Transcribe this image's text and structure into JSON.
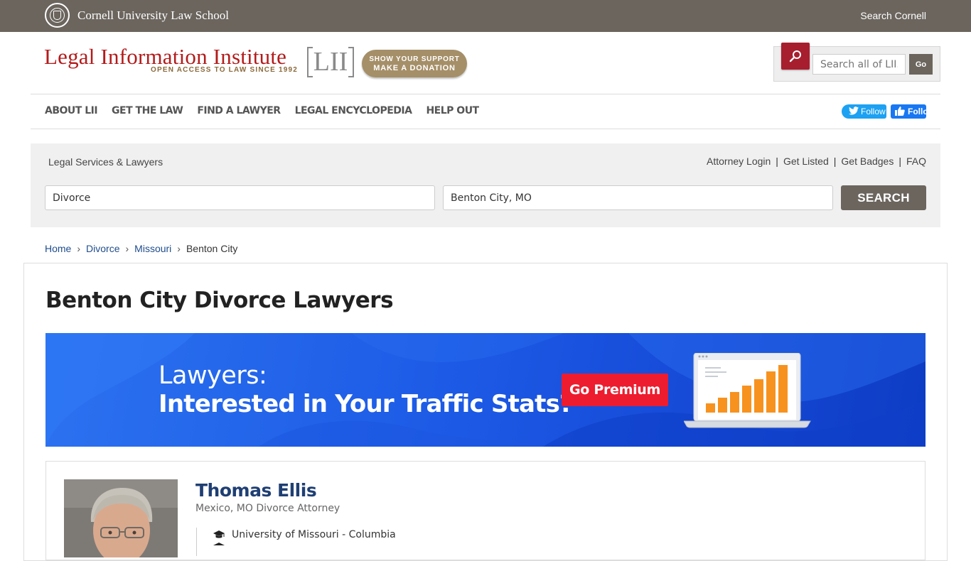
{
  "cornell_bar": {
    "name": "Cornell University Law School",
    "search_link": "Search Cornell"
  },
  "header": {
    "title": "Legal Information Institute",
    "tagline": "OPEN ACCESS TO LAW SINCE 1992",
    "mark": "LII",
    "donate": {
      "line1": "SHOW YOUR SUPPORT",
      "line2": "MAKE A DONATION"
    },
    "search": {
      "placeholder": "Search all of LII...",
      "go_label": "Go",
      "icon": "search-icon"
    }
  },
  "nav": {
    "items": [
      "ABOUT LII",
      "GET THE LAW",
      "FIND A LAWYER",
      "LEGAL ENCYCLOPEDIA",
      "HELP OUT"
    ],
    "twitter_follow": "Follow",
    "facebook_follow": "Follow"
  },
  "lawyer_search": {
    "title": "Legal Services & Lawyers",
    "links": [
      "Attorney Login",
      "Get Listed",
      "Get Badges",
      "FAQ"
    ],
    "practice_value": "Divorce",
    "location_value": "Benton City, MO",
    "button_label": "SEARCH"
  },
  "breadcrumb": {
    "items": [
      "Home",
      "Divorce",
      "Missouri"
    ],
    "current": "Benton City"
  },
  "page": {
    "title": "Benton City Divorce Lawyers"
  },
  "banner": {
    "line1": "Lawyers:",
    "line2": "Interested in Your Traffic Stats?",
    "cta": "Go Premium",
    "colors": {
      "background": "#1d5be6",
      "cta": "#ed1c2e",
      "bars": "#f7921e"
    }
  },
  "listing": {
    "name": "Thomas Ellis",
    "subtitle": "Mexico, MO Divorce Attorney",
    "education": "University of Missouri - Columbia"
  },
  "colors": {
    "cornell_bar": "#6b655e",
    "lii_red": "#b31b1b",
    "link_blue": "#1f4d8c",
    "name_blue": "#1f3f73"
  }
}
